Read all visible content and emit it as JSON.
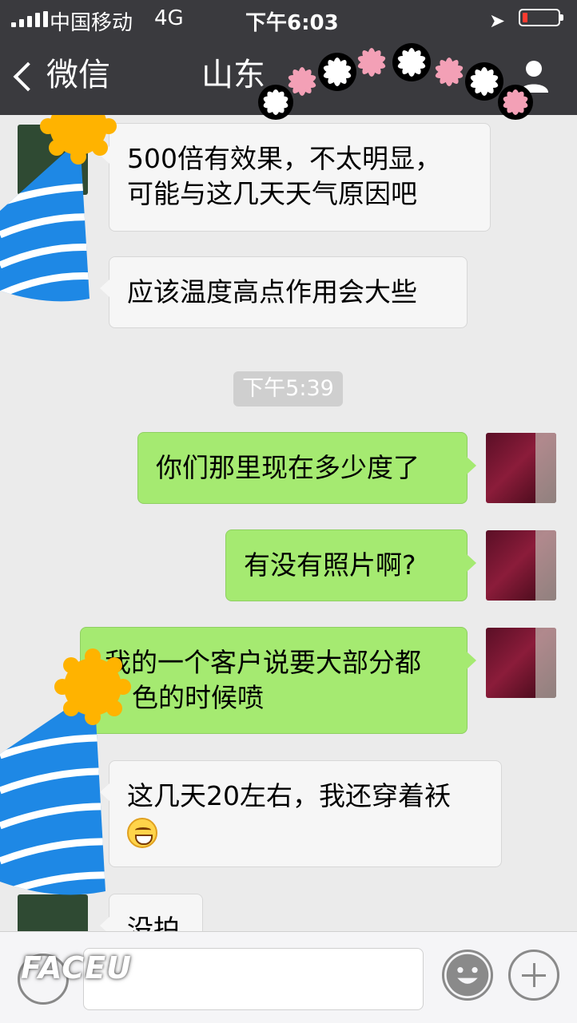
{
  "status_bar": {
    "carrier": "中国移动",
    "network": "4G",
    "time": "下午6:03"
  },
  "nav": {
    "back_label": "微信",
    "title": "山东",
    "accent_color": "#3a3a3e"
  },
  "messages": [
    {
      "side": "them",
      "text_line1": "500倍有效果，不太明显，",
      "text_line2": "可能与这几天天气原因吧"
    },
    {
      "side": "them",
      "text": "应该温度高点作用会大些"
    },
    {
      "type": "time",
      "text": "下午5:39"
    },
    {
      "side": "me",
      "text": "你们那里现在多少度了"
    },
    {
      "side": "me",
      "text": "有没有照片啊?"
    },
    {
      "side": "me",
      "text_line1": "我的一个客户说要大部分都",
      "text_line2": "色的时候喷"
    },
    {
      "side": "them",
      "text_line1": "这几天20左右，我还穿着袄",
      "emoji": "grinning-emoji"
    },
    {
      "side": "them",
      "text": "没拍"
    }
  ],
  "input_bar": {
    "placeholder": "",
    "watermark": "FACEU"
  },
  "colors": {
    "bubble_me": "#a5ea71",
    "bubble_them": "#f6f6f6",
    "background": "#ebebeb"
  }
}
